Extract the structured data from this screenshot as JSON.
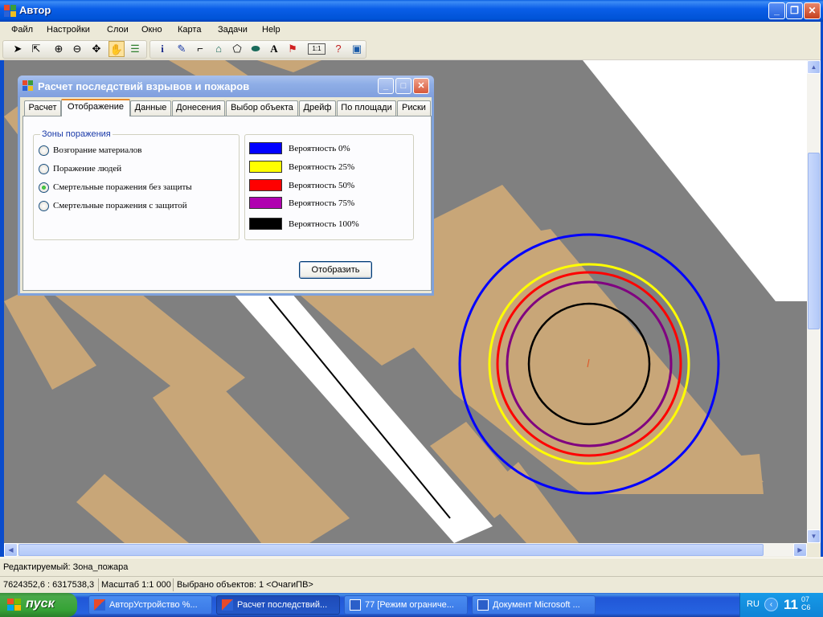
{
  "window": {
    "title": "Автор"
  },
  "menu": [
    "Файл",
    "Настройки",
    "Слои",
    "Окно",
    "Карта",
    "Задачи",
    "Help"
  ],
  "toolbar": {
    "tools": [
      "arrow-icon",
      "select-arrow-icon",
      "zoom-in-icon",
      "zoom-out-icon",
      "pan-arrows-icon",
      "hand-icon",
      "layers-icon",
      "info-icon",
      "pin-icon",
      "line-icon",
      "house-icon",
      "polygon-icon",
      "ellipse-icon",
      "text-icon",
      "flag-icon",
      "scale-icon",
      "question-pointer-icon",
      "picture-icon"
    ],
    "active_tool": "hand-icon",
    "scale_label": "1:1"
  },
  "dialog": {
    "title": "Расчет последствий взрывов и пожаров",
    "tabs": [
      "Расчет",
      "Отображение",
      "Данные",
      "Донесения",
      "Выбор объекта",
      "Дрейф",
      "По площади",
      "Риски"
    ],
    "active_tab": "Отображение",
    "zones_group": {
      "legend": "Зоны поражения",
      "options": [
        {
          "label": "Возгорание материалов",
          "selected": false
        },
        {
          "label": "Поражение людей",
          "selected": false
        },
        {
          "label": "Смертельные поражения без защиты",
          "selected": true
        },
        {
          "label": "Смертельные поражения с защитой",
          "selected": false
        }
      ]
    },
    "probabilities": [
      {
        "color": "#0000ff",
        "label": "Вероятность 0%"
      },
      {
        "color": "#ffff00",
        "label": "Вероятность 25%"
      },
      {
        "color": "#ff0000",
        "label": "Вероятность 50%"
      },
      {
        "color": "#b000b0",
        "label": "Вероятность 75%"
      },
      {
        "color": "#000000",
        "label": "Вероятность 100%"
      }
    ],
    "show_button": "Отобразить"
  },
  "map": {
    "colors": {
      "background": "#808080",
      "building": "#c8a678",
      "road": "#ffffff"
    },
    "zone_circles": [
      "#0000ff",
      "#ffff00",
      "#ff0000",
      "#800080",
      "#000000"
    ]
  },
  "status": {
    "editing": "Редактируемый: Зона_пожара",
    "coords": "7624352,6 : 6317538,3",
    "scale": "Масштаб 1:1 000",
    "selected": "Выбрано объектов: 1 <ОчагиПВ>"
  },
  "taskbar": {
    "start": "пуск",
    "tasks": [
      {
        "label": "АвторУстройство %...",
        "active": false
      },
      {
        "label": "Расчет последствий...",
        "active": true
      },
      {
        "label": "77 [Режим ограниче...",
        "active": false
      },
      {
        "label": "Документ Microsoft ...",
        "active": false
      }
    ],
    "lang": "RU",
    "time": "11",
    "time_minutes": "07",
    "day": "С6"
  }
}
